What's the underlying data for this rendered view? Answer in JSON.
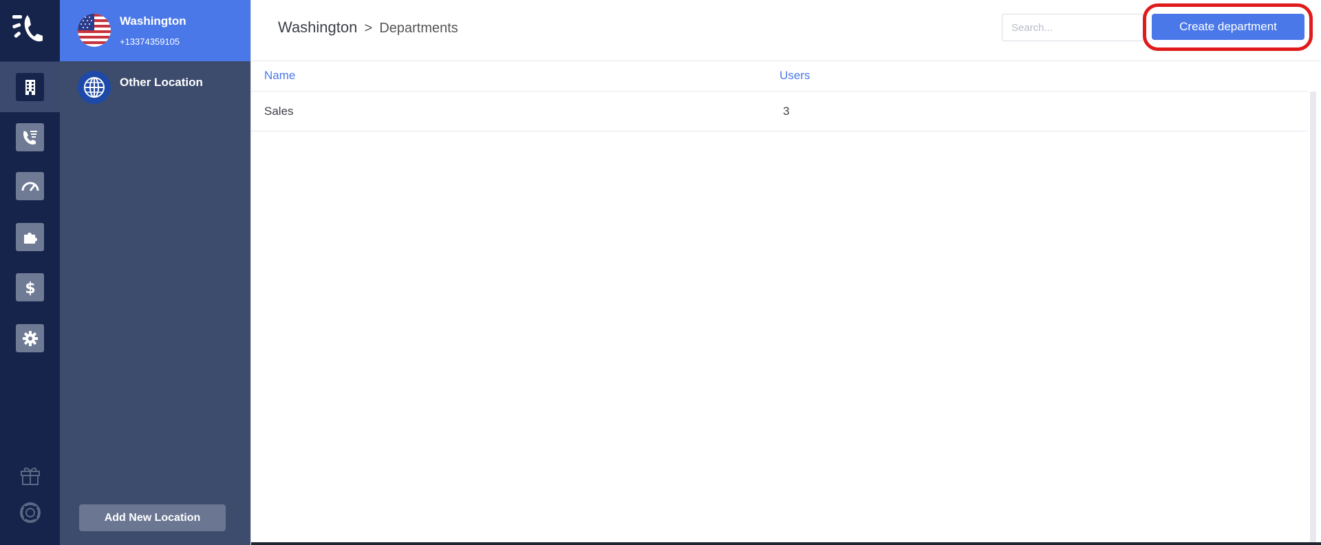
{
  "rail": {
    "items": [
      {
        "name": "locations",
        "icon": "building-icon",
        "active": true
      },
      {
        "name": "call-flows",
        "icon": "phone-list-icon",
        "active": false
      },
      {
        "name": "dashboard",
        "icon": "speedometer-icon",
        "active": false
      },
      {
        "name": "integrations",
        "icon": "puzzle-icon",
        "active": false
      },
      {
        "name": "billing",
        "icon": "dollar-icon",
        "active": false
      },
      {
        "name": "settings",
        "icon": "gear-icon",
        "active": false
      }
    ],
    "bottom": [
      {
        "name": "gift",
        "icon": "gift-icon"
      },
      {
        "name": "support",
        "icon": "lifebuoy-icon"
      }
    ]
  },
  "locations": {
    "items": [
      {
        "title": "Washington",
        "subtitle": "+13374359105",
        "icon": "us-flag-icon",
        "active": true
      },
      {
        "title": "Other Location",
        "subtitle": "",
        "icon": "globe-icon",
        "active": false
      }
    ],
    "add_label": "Add New Location"
  },
  "header": {
    "location": "Washington",
    "separator": ">",
    "page": "Departments",
    "search_placeholder": "Search...",
    "create_label": "Create department"
  },
  "table": {
    "columns": [
      "Name",
      "Users"
    ],
    "rows": [
      {
        "name": "Sales",
        "users": "3"
      }
    ]
  },
  "colors": {
    "accent": "#4a78e8",
    "rail_bg": "#16234a",
    "panel_bg": "#3d4b6d",
    "highlight": "#e01b1b"
  }
}
